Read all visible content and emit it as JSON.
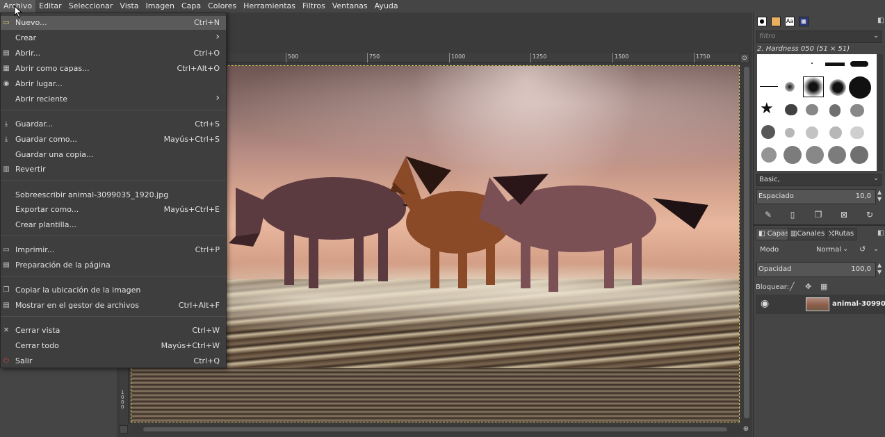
{
  "menubar": {
    "items": [
      "Archivo",
      "Editar",
      "Seleccionar",
      "Vista",
      "Imagen",
      "Capa",
      "Colores",
      "Herramientas",
      "Filtros",
      "Ventanas",
      "Ayuda"
    ]
  },
  "file_menu": {
    "items": [
      {
        "label": "Nuevo...",
        "shortcut": "Ctrl+N",
        "icon": "new-file-icon"
      },
      {
        "label": "Crear",
        "shortcut": "›",
        "icon": ""
      },
      {
        "label": "Abrir...",
        "shortcut": "Ctrl+O",
        "icon": "open-icon"
      },
      {
        "label": "Abrir como capas...",
        "shortcut": "Ctrl+Alt+O",
        "icon": "open-as-layers-icon"
      },
      {
        "label": "Abrir lugar...",
        "shortcut": "",
        "icon": "open-location-icon"
      },
      {
        "label": "Abrir reciente",
        "shortcut": "›",
        "icon": ""
      },
      {
        "label": "Guardar...",
        "shortcut": "Ctrl+S",
        "icon": "save-icon"
      },
      {
        "label": "Guardar como...",
        "shortcut": "Mayús+Ctrl+S",
        "icon": "save-as-icon"
      },
      {
        "label": "Guardar una copia...",
        "shortcut": "",
        "icon": ""
      },
      {
        "label": "Revertir",
        "shortcut": "",
        "icon": "revert-icon"
      },
      {
        "label": "Sobreescribir animal-3099035_1920.jpg",
        "shortcut": "",
        "icon": ""
      },
      {
        "label": "Exportar como...",
        "shortcut": "Mayús+Ctrl+E",
        "icon": ""
      },
      {
        "label": "Crear plantilla...",
        "shortcut": "",
        "icon": ""
      },
      {
        "label": "Imprimir...",
        "shortcut": "Ctrl+P",
        "icon": "print-icon"
      },
      {
        "label": "Preparación de la página",
        "shortcut": "",
        "icon": "page-setup-icon"
      },
      {
        "label": "Copiar la ubicación de la imagen",
        "shortcut": "",
        "icon": "copy-location-icon"
      },
      {
        "label": "Mostrar en el gestor de archivos",
        "shortcut": "Ctrl+Alt+F",
        "icon": "file-manager-icon"
      },
      {
        "label": "Cerrar vista",
        "shortcut": "Ctrl+W",
        "icon": "close-view-icon"
      },
      {
        "label": "Cerrar todo",
        "shortcut": "Mayús+Ctrl+W",
        "icon": "close-all-icon"
      },
      {
        "label": "Salir",
        "shortcut": "Ctrl+Q",
        "icon": "quit-icon"
      }
    ]
  },
  "ruler": {
    "h_labels": [
      "500",
      "750",
      "1000",
      "1250",
      "1500",
      "1750"
    ],
    "v_label": "1000"
  },
  "dock": {
    "brushes": {
      "filter_placeholder": "filtro",
      "selected_brush": "2. Hardness 050 (51 × 51)",
      "preset": "Basic,",
      "spacing_label": "Espaciado",
      "spacing_value": "10,0"
    },
    "layers": {
      "tabs": [
        "Capas",
        "Canales",
        "Rutas"
      ],
      "mode_label": "Modo",
      "mode_value": "Normal",
      "opacity_label": "Opacidad",
      "opacity_value": "100,0",
      "lock_label": "Bloquear:",
      "layer_name": "animal-30990"
    }
  },
  "colors": {
    "accent": "#e0d060",
    "menu_bg": "#3e3e3e",
    "highlight": "#5a5a5a"
  }
}
